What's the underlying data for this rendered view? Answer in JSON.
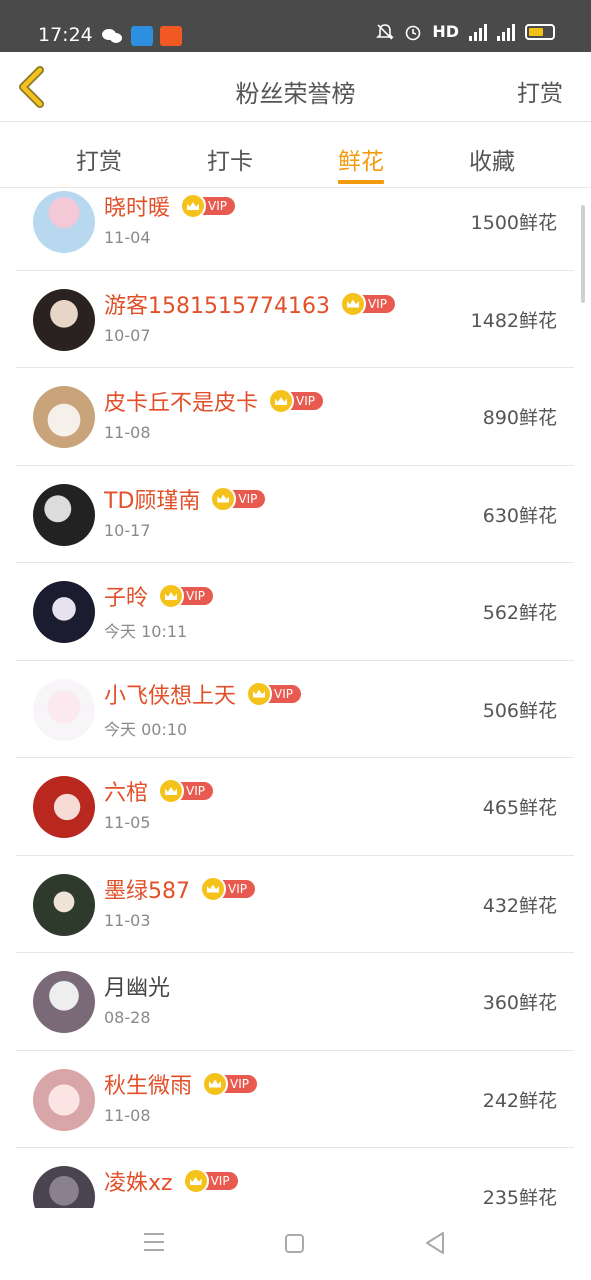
{
  "status_bar": {
    "time": "17:24",
    "network_label": "HD",
    "icons": [
      "wechat-icon",
      "app-icon",
      "app-icon",
      "mute-bell-icon",
      "alarm-icon",
      "signal-icon",
      "signal-icon",
      "battery-icon"
    ]
  },
  "header": {
    "title": "粉丝荣誉榜",
    "action_label": "打赏",
    "back_icon": "chevron-left-icon"
  },
  "tabs": [
    {
      "label": "打赏"
    },
    {
      "label": "打卡"
    },
    {
      "label": "鲜花"
    },
    {
      "label": "收藏"
    }
  ],
  "active_tab": "鲜花",
  "vip_label": "VIP",
  "fans": [
    {
      "name": "晓时暖",
      "date": "11-04",
      "amount": "1500鲜花",
      "vip": true
    },
    {
      "name": "游客1581515774163",
      "date": "10-07",
      "amount": "1482鲜花",
      "vip": true
    },
    {
      "name": "皮卡丘不是皮卡",
      "date": "11-08",
      "amount": "890鲜花",
      "vip": true
    },
    {
      "name": "TD顾瑾南",
      "date": "10-17",
      "amount": "630鲜花",
      "vip": true
    },
    {
      "name": "子昤",
      "date": "今天 10:11",
      "amount": "562鲜花",
      "vip": true
    },
    {
      "name": "小飞侠想上天",
      "date": "今天 00:10",
      "amount": "506鲜花",
      "vip": true
    },
    {
      "name": "六棺",
      "date": "11-05",
      "amount": "465鲜花",
      "vip": true
    },
    {
      "name": "墨绿587",
      "date": "11-03",
      "amount": "432鲜花",
      "vip": true
    },
    {
      "name": "月幽光",
      "date": "08-28",
      "amount": "360鲜花",
      "vip": false
    },
    {
      "name": "秋生微雨",
      "date": "11-08",
      "amount": "242鲜花",
      "vip": true
    },
    {
      "name": "凌姝xz",
      "date": "",
      "amount": "235鲜花",
      "vip": true
    }
  ],
  "colors": {
    "accent": "#f29b0d",
    "vip_name": "#e2502a",
    "vip_badge": "#e85a4f",
    "crown": "#f5c21b",
    "status_bar": "#4a4a4a"
  }
}
